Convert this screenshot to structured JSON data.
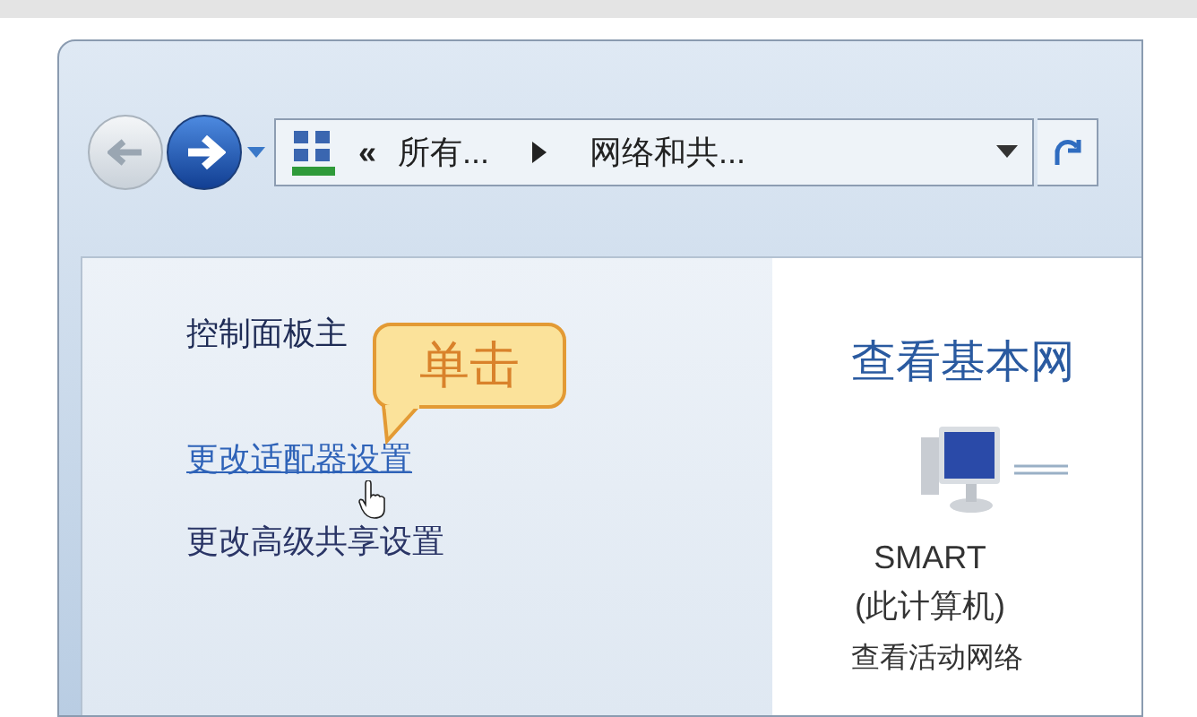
{
  "address_bar": {
    "overflow": "«",
    "crumbs": [
      "所有...",
      "网络和共..."
    ]
  },
  "sidebar": {
    "items": [
      {
        "label": "控制面板主",
        "kind": "plain",
        "hovered": false
      },
      {
        "label": "更改适配器设置",
        "kind": "link",
        "hovered": true
      },
      {
        "label": "更改高级共享设置",
        "kind": "link",
        "hovered": false
      }
    ]
  },
  "callout": {
    "text": "单击"
  },
  "main": {
    "title": "查看基本网",
    "computer": {
      "name": "SMART",
      "caption": "(此计算机)"
    },
    "section": "查看活动网络"
  }
}
